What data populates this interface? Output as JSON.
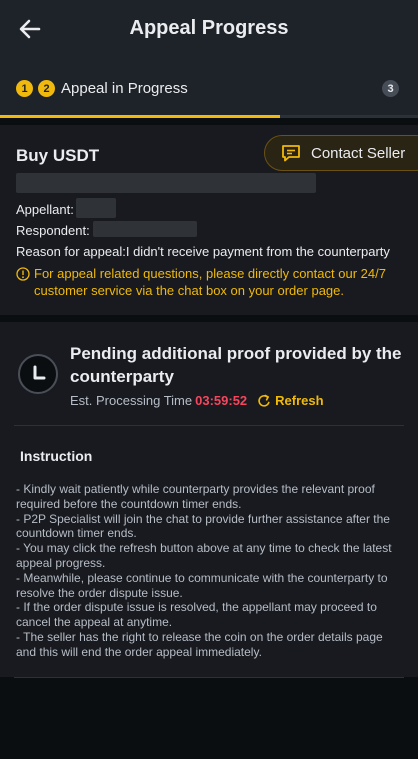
{
  "header": {
    "title": "Appeal Progress",
    "back_icon": "arrow-left-icon"
  },
  "progress": {
    "steps": [
      "1",
      "2",
      "3"
    ],
    "current_label": "Appeal in Progress"
  },
  "order": {
    "title": "Buy USDT",
    "contact_label": "Contact Seller",
    "appellant_label": "Appellant:",
    "respondent_label": "Respondent:",
    "reason": "Reason for appeal:I didn't receive payment from the counterparty",
    "notice": "For appeal related questions, please directly contact our 24/7 customer service via the chat box on your order page."
  },
  "status": {
    "title": "Pending additional proof provided by the counterparty",
    "est_label": "Est. Processing Time",
    "timer": "03:59:52",
    "refresh_label": "Refresh"
  },
  "instruction": {
    "title": "Instruction",
    "items": [
      "- Kindly wait patiently while counterparty provides the relevant proof required before the countdown timer ends.",
      "- P2P Specialist will join the chat to provide further assistance after the countdown timer ends.",
      "- You may click the refresh button above at any time to check the latest appeal progress.",
      "- Meanwhile, please continue to communicate with the counterparty to resolve the order dispute issue.",
      "- If the order dispute issue is resolved, the appellant may proceed to cancel the appeal at anytime.",
      "- The seller has the right to release the coin on the order details page and this will end the order appeal immediately."
    ]
  },
  "colors": {
    "accent": "#f0b90b",
    "timer": "#f6465d",
    "background": "#0b0e11",
    "card": "#181a20"
  }
}
